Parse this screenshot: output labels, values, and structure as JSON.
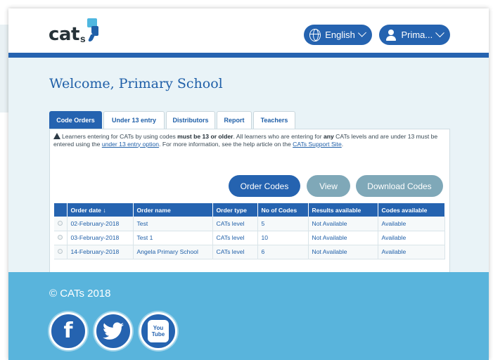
{
  "header": {
    "logo_text": "cat",
    "logo_suffix": "s",
    "language_label": "English",
    "user_label": "Prima..."
  },
  "main": {
    "welcome": "Welcome, Primary School",
    "tabs": [
      {
        "label": "Code Orders",
        "active": true
      },
      {
        "label": "Under 13 entry",
        "active": false
      },
      {
        "label": "Distributors",
        "active": false
      },
      {
        "label": "Report",
        "active": false
      },
      {
        "label": "Teachers",
        "active": false
      }
    ],
    "notice": {
      "part1": "Learners entering for CATs by using codes ",
      "bold1": "must be 13 or older",
      "part2": ". All learners who are entering for ",
      "bold2": "any",
      "part3": " CATs levels and are under 13 must be entered using the ",
      "link1": "under 13 entry option",
      "part4": ". For more information, see the help article on the ",
      "link2": "CATs Support Site",
      "part5": "."
    },
    "buttons": {
      "order": "Order Codes",
      "view": "View",
      "download": "Download Codes"
    },
    "table": {
      "headers": [
        "Order date ↓",
        "Order name",
        "Order type",
        "No of Codes",
        "Results available",
        "Codes available"
      ],
      "rows": [
        [
          "02-February-2018",
          "Test",
          "CATs level",
          "5",
          "Not Available",
          "Available"
        ],
        [
          "03-February-2018",
          "Test 1",
          "CATs level",
          "10",
          "Not Available",
          "Available"
        ],
        [
          "14-February-2018",
          "Angela Primary School",
          "CATs level",
          "6",
          "Not Available",
          "Available"
        ]
      ]
    }
  },
  "footer": {
    "copyright": "© CATs 2018",
    "social": {
      "facebook_glyph": "f",
      "youtube_top": "You",
      "youtube_bottom": "Tube"
    }
  },
  "colors": {
    "primary": "#2563b0",
    "footer": "#59b4dc",
    "muted_button": "#7fa8b8",
    "main_bg": "#e9f3f7"
  }
}
